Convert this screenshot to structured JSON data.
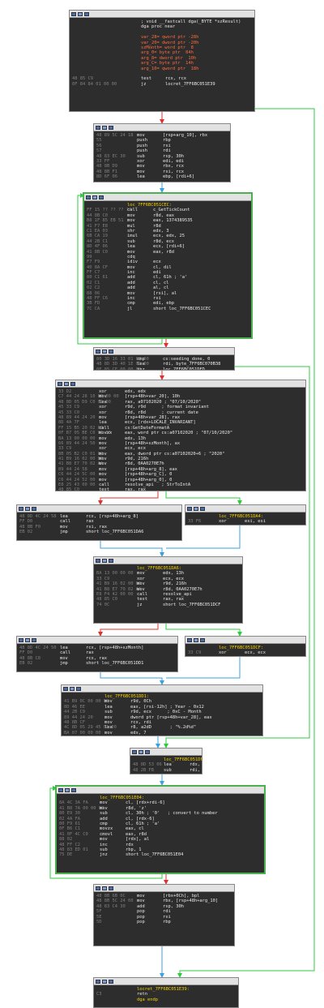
{
  "nodes": [
    {
      "lines": [
        {
          "t": "hdr",
          "text": "; void __fastcall dga(_BYTE *szResult)"
        },
        {
          "t": "hdr",
          "text": "dga proc near"
        },
        {
          "t": "hdr",
          "text": ""
        },
        {
          "t": "var",
          "text": "var_28= qword ptr -28h"
        },
        {
          "t": "var",
          "text": "var_20= dword ptr -20h"
        },
        {
          "t": "var",
          "text": "szMonth= word ptr  8"
        },
        {
          "t": "var",
          "text": "arg_0= byte ptr  04h"
        },
        {
          "t": "var",
          "text": "arg_8= dword ptr  10h"
        },
        {
          "t": "var",
          "text": "arg_C= byte ptr  14h"
        },
        {
          "t": "var",
          "text": "arg_10= qword ptr  18h"
        },
        {
          "t": "hdr",
          "text": ""
        },
        {
          "a": "48 85 C9",
          "m": "test",
          "o": "rcx, rcx"
        },
        {
          "a": "0F 84 84 01 00 00",
          "m": "jz",
          "o": "locret_7FF6BC051E39"
        }
      ]
    },
    {
      "lines": [
        {
          "a": "48 89 5C 24 18",
          "m": "mov",
          "o": "[rsp+arg_10], rbx"
        },
        {
          "a": "55",
          "m": "push",
          "o": "rbp"
        },
        {
          "a": "56",
          "m": "push",
          "o": "rsi"
        },
        {
          "a": "57",
          "m": "push",
          "o": "rdi"
        },
        {
          "a": "48 83 EC 30",
          "m": "sub",
          "o": "rsp, 30h"
        },
        {
          "a": "33 FF",
          "m": "xor",
          "o": "edi, edi"
        },
        {
          "a": "48 8B D9",
          "m": "mov",
          "o": "rbx, rcx"
        },
        {
          "a": "48 8B F1",
          "m": "mov",
          "o": "rsi, rcx"
        },
        {
          "a": "8D 6F 06",
          "m": "lea",
          "o": "ebp, [rdi+6]"
        }
      ]
    },
    {
      "lines": [
        {
          "label": "loc_7FF6BC051CEC:"
        },
        {
          "a": "FF 15 ?? ?? ?? ??",
          "m": "call",
          "o": "c_GetTickCount"
        },
        {
          "a": "44 8B C0",
          "m": "mov",
          "o": "r8d, eax"
        },
        {
          "a": "B8 1F 85 EB 51",
          "m": "mov",
          "o": "eax, 1374389535"
        },
        {
          "a": "41 F7 E8",
          "m": "mul",
          "o": "r8d"
        },
        {
          "a": "C1 EA 03",
          "m": "shr",
          "o": "edx, 3"
        },
        {
          "a": "6B CA 19",
          "m": "imul",
          "o": "ecx, edx, 25"
        },
        {
          "a": "44 2B C1",
          "m": "sub",
          "o": "r8d, ecx"
        },
        {
          "a": "8D 4F 06",
          "m": "lea",
          "o": "ecx, [rdi+6]"
        },
        {
          "a": "41 8B C0",
          "m": "mov",
          "o": "eax, r8d"
        },
        {
          "a": "99",
          "m": "cdq",
          "o": ""
        },
        {
          "a": "F7 F9",
          "m": "idiv",
          "o": "ecx"
        },
        {
          "a": "40 8A CF",
          "m": "mov",
          "o": "cl, dil"
        },
        {
          "a": "FF C7",
          "m": "inc",
          "o": "edi"
        },
        {
          "a": "80 C1 61",
          "m": "add",
          "o": "cl, 61h ; 'a'"
        },
        {
          "a": "02 C1",
          "m": "add",
          "o": "cl, cl"
        },
        {
          "a": "02 C2",
          "m": "add",
          "o": "al, cl"
        },
        {
          "a": "88 06",
          "m": "mov",
          "o": "[rsi], al"
        },
        {
          "a": "48 FF C6",
          "m": "inc",
          "o": "rsi"
        },
        {
          "a": "3B FD",
          "m": "cmp",
          "o": "edi, ebp"
        },
        {
          "a": "7C CA",
          "m": "jl",
          "o": "short loc_7FF6BC051CEC"
        }
      ]
    },
    {
      "lines": [
        {
          "a": "80 3D 16 33 01 00 00",
          "m": "cmp",
          "o": "cs:seeding_done, 0"
        },
        {
          "a": "48 8D 3D 40 1E 01 00",
          "m": "lea",
          "o": "rdi, byte_7FF6BC070B38"
        },
        {
          "a": "0F 85 CF 00 00 00",
          "m": "jnz",
          "o": "loc_7FF6BC051DFD"
        }
      ]
    },
    {
      "lines": [
        {
          "a": "33 D2",
          "m": "xor",
          "o": "edx, edx"
        },
        {
          "a": "C7 44 24 28 10 00 00 00",
          "m": "mov",
          "o": "[rsp+48h+var_20], 10h"
        },
        {
          "a": "48 8D 05 D9 C0 01 00",
          "m": "lea",
          "o": "rax, a07102020 ; \"07/10/2020\""
        },
        {
          "a": "45 33 C9",
          "m": "xor",
          "o": "r9d, r9d      ; format invariant"
        },
        {
          "a": "45 33 C0",
          "m": "xor",
          "o": "r8d, r8d      ; current date"
        },
        {
          "a": "48 89 44 24 20",
          "m": "mov",
          "o": "[rsp+48h+var_28], rax"
        },
        {
          "a": "8D 4A 7F",
          "m": "lea",
          "o": "ecx, [rdx+LOCALE_INVARIANT]"
        },
        {
          "a": "FF 15 B5 20 02 00",
          "m": "call",
          "o": "cs:GetDateFormatA"
        },
        {
          "a": "0F B7 05 BE C0 01 00",
          "m": "movzx",
          "o": "eax, word ptr cs:a07102020 ; \"07/10/2020\""
        },
        {
          "a": "BA 13 00 00 00",
          "m": "mov",
          "o": "edx, 13h"
        },
        {
          "a": "66 89 44 24 50",
          "m": "mov",
          "o": "[rsp+48h+szMonth], ax"
        },
        {
          "a": "33 C9",
          "m": "xor",
          "o": "ecx, ecx"
        },
        {
          "a": "8B 05 B2 C0 01 00",
          "m": "mov",
          "o": "eax, dword ptr cs:a07102020+6 ; \"2020\""
        },
        {
          "a": "41 B9 16 02 00 00",
          "m": "mov",
          "o": "r9d, 216h"
        },
        {
          "a": "41 B8 E7 70 02 AA",
          "m": "mov",
          "o": "r8d, 0AA0270E7h"
        },
        {
          "a": "89 44 24 58",
          "m": "mov",
          "o": "[rsp+48h+arg_8], eax"
        },
        {
          "a": "C6 44 24 5C 00",
          "m": "mov",
          "o": "[rsp+48h+arg_C], 0"
        },
        {
          "a": "C6 44 24 52 00",
          "m": "mov",
          "o": "[rsp+48h+arg_0], 0"
        },
        {
          "a": "E8 25 43 00 00",
          "m": "call",
          "o": "resolve_api   ; StrToIntA"
        },
        {
          "a": "48 85 C0",
          "m": "test",
          "o": "rax, rax"
        },
        {
          "a": "74 0C",
          "m": "jz",
          "o": "short loc_7FF6BC051DA4"
        }
      ]
    },
    {
      "lines": [
        {
          "a": "48 8D 4C 24 58",
          "m": "lea",
          "o": "rcx, [rsp+48h+arg_8]"
        },
        {
          "a": "FF D0",
          "m": "call",
          "o": "rax"
        },
        {
          "a": "48 8B F0",
          "m": "mov",
          "o": "rsi, rax"
        },
        {
          "a": "EB 02",
          "m": "jmp",
          "o": "short loc_7FF6BC051DA6"
        }
      ]
    },
    {
      "lines": [
        {
          "label": "loc_7FF6BC051DA4:"
        },
        {
          "a": "33 F6",
          "m": "xor",
          "o": "esi, esi"
        }
      ]
    },
    {
      "lines": [
        {
          "label": "loc_7FF6BC051DA6:"
        },
        {
          "a": "BA 13 00 00 00",
          "m": "mov",
          "o": "edx, 13h"
        },
        {
          "a": "33 C9",
          "m": "xor",
          "o": "ecx, ecx"
        },
        {
          "a": "41 B9 16 02 00 00",
          "m": "mov",
          "o": "r9d, 216h"
        },
        {
          "a": "41 B8 E7 70 02 AA",
          "m": "mov",
          "o": "r8d, 0AA0270E7h"
        },
        {
          "a": "E8 F4 42 00 00",
          "m": "call",
          "o": "resolve_api"
        },
        {
          "a": "48 85 C0",
          "m": "test",
          "o": "rax, rax"
        },
        {
          "a": "74 0C",
          "m": "jz",
          "o": "short loc_7FF6BC051DCF"
        }
      ]
    },
    {
      "lines": [
        {
          "a": "48 8D 4C 24 50",
          "m": "lea",
          "o": "rcx, [rsp+48h+szMonth]"
        },
        {
          "a": "FF D0",
          "m": "call",
          "o": "rax"
        },
        {
          "a": "48 8B C8",
          "m": "mov",
          "o": "rcx, rax"
        },
        {
          "a": "EB 02",
          "m": "jmp",
          "o": "short loc_7FF6BC051DD1"
        }
      ]
    },
    {
      "lines": [
        {
          "label": "loc_7FF6BC051DCF:"
        },
        {
          "a": "33 C9",
          "m": "xor",
          "o": "ecx, ecx"
        }
      ]
    },
    {
      "lines": [
        {
          "label": "loc_7FF6BC051DD1:"
        },
        {
          "a": "41 B9 0C 00 00 00",
          "m": "mov",
          "o": "r9d, 0Ch"
        },
        {
          "a": "8D 46 EE",
          "m": "lea",
          "o": "eax, [rsi-12h] ; Year - 0x12"
        },
        {
          "a": "44 2B C9",
          "m": "sub",
          "o": "r9d, ecx      ; 0xC - Month"
        },
        {
          "a": "89 44 24 20",
          "m": "mov",
          "o": "dword ptr [rsp+48h+var_28], eax"
        },
        {
          "a": "48 8B CF",
          "m": "mov",
          "o": "rcx, rdi"
        },
        {
          "a": "4C 8D 05 29 45 01 00",
          "m": "lea",
          "o": "r8, a2dD       ; \"%.2d%d\""
        },
        {
          "a": "BA 07 00 00 00",
          "m": "mov",
          "o": "edx, 7"
        },
        {
          "a": "FF 15 32 20 02 00",
          "m": "call",
          "o": "cs:wnsprintfA"
        },
        {
          "a": "C6 05 42 33 01 00 01",
          "m": "mov",
          "o": "cs:seeding_done, 1"
        }
      ]
    },
    {
      "lines": [
        {
          "label": "loc_7FF6BC051DFD:"
        },
        {
          "a": "48 8D 53 06",
          "m": "lea",
          "o": "rdx, [rbx+6]"
        },
        {
          "a": "48 2B FB",
          "m": "sub",
          "o": "rdi, rbx"
        }
      ]
    },
    {
      "lines": [
        {
          "label": "loc_7FF6BC051E04:"
        },
        {
          "a": "8A 4C 3A FA",
          "m": "mov",
          "o": "cl, [rdx+rdi-6]"
        },
        {
          "a": "41 B8 7A 00 00 00",
          "m": "mov",
          "o": "r8d, 'z'"
        },
        {
          "a": "80 E9 30",
          "m": "sub",
          "o": "cl, 30h ; '0'   ; convert to number"
        },
        {
          "a": "02 4A FA",
          "m": "add",
          "o": "cl, [rdx-6]"
        },
        {
          "a": "80 F9 61",
          "m": "cmp",
          "o": "cl, 61h ; 'a'"
        },
        {
          "a": "0F B6 C1",
          "m": "movzx",
          "o": "eax, cl"
        },
        {
          "a": "41 0F 4C C0",
          "m": "cmovl",
          "o": "eax, r8d"
        },
        {
          "a": "88 02",
          "m": "mov",
          "o": "[rdx], al"
        },
        {
          "a": "48 FF C2",
          "m": "inc",
          "o": "rdx"
        },
        {
          "a": "48 83 ED 01",
          "m": "sub",
          "o": "rbp, 1"
        },
        {
          "a": "75 DE",
          "m": "jnz",
          "o": "short loc_7FF6BC051E04"
        }
      ]
    },
    {
      "lines": [
        {
          "a": "48 8B 6B 0C",
          "m": "mov",
          "o": "[rbx+0Ch], bpl"
        },
        {
          "a": "48 8B 5C 24 60",
          "m": "mov",
          "o": "rbx, [rsp+48h+arg_10]"
        },
        {
          "a": "48 83 C4 30",
          "m": "add",
          "o": "rsp, 30h"
        },
        {
          "a": "5F",
          "m": "pop",
          "o": "rdi"
        },
        {
          "a": "5E",
          "m": "pop",
          "o": "rsi"
        },
        {
          "a": "5D",
          "m": "pop",
          "o": "rbp"
        }
      ]
    },
    {
      "lines": [
        {
          "label": "locret_7FF6BC051E39:"
        },
        {
          "a": "C3",
          "m": "retn",
          "o": ""
        },
        {
          "m": "",
          "o": "",
          "label2": "dga endp"
        }
      ]
    }
  ]
}
